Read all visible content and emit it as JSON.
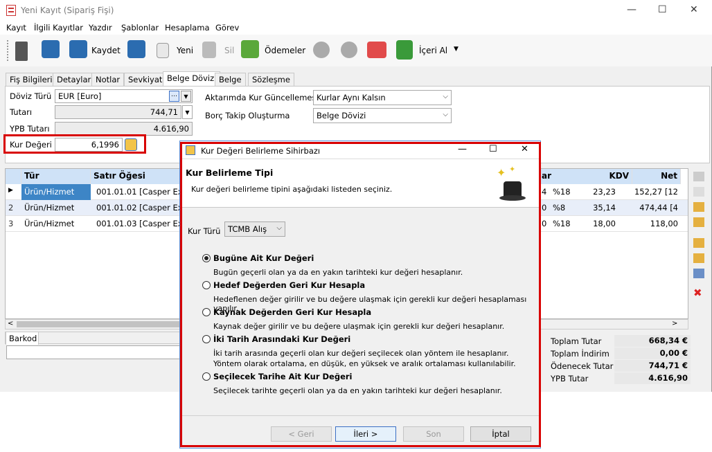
{
  "window": {
    "title": "Yeni Kayıt (Sipariş Fişi)",
    "controls": {
      "minimize": "—",
      "maximize": "☐",
      "close": "✕"
    }
  },
  "menu": [
    "Kayıt",
    "İlgili Kayıtlar",
    "Yazdır",
    "Şablonlar",
    "Hesaplama",
    "Görev"
  ],
  "toolbar": {
    "save": "Kaydet",
    "new": "Yeni",
    "delete": "Sil",
    "payments": "Ödemeler",
    "import": "İçeri Al"
  },
  "tabs": [
    "Fiş Bilgileri",
    "Detaylar",
    "Notlar",
    "Sevkiyat",
    "Belge Dövizi",
    "Belge",
    "Sözleşme"
  ],
  "form": {
    "currency_type_label": "Döviz Türü",
    "currency_type_value": "EUR [Euro]",
    "amount_label": "Tutarı",
    "amount_value": "744,71",
    "ypb_label": "YPB Tutarı",
    "ypb_value": "4.616,90",
    "rate_label": "Kur Değeri",
    "rate_value": "6,1996",
    "update_label": "Aktarımda Kur Güncellemesi",
    "update_value": "Kurlar Aynı Kalsın",
    "debt_label": "Borç Takip Oluşturma",
    "debt_value": "Belge Dövizi"
  },
  "grid": {
    "headers": {
      "type": "Tür",
      "item": "Satır Öğesi",
      "col_partial": "ar",
      "kdv": "KDV",
      "net": "Net"
    },
    "rows": [
      {
        "num": "1",
        "type": "Ürün/Hizmet",
        "item": "001.01.01 [Casper Excalib",
        "q": "4",
        "rate": "%18",
        "kdv": "23,23",
        "net": "152,27 [12"
      },
      {
        "num": "2",
        "type": "Ürün/Hizmet",
        "item": "001.01.02 [Casper Excalib",
        "q": "0",
        "rate": "%8",
        "kdv": "35,14",
        "net": "474,44 [4"
      },
      {
        "num": "3",
        "type": "Ürün/Hizmet",
        "item": "001.01.03 [Casper Excalib",
        "q": "0",
        "rate": "%18",
        "kdv": "18,00",
        "net": "118,00"
      }
    ]
  },
  "barcode_label": "Barkod",
  "totals": [
    {
      "label": "Toplam Tutar",
      "value": "668,34 €"
    },
    {
      "label": "Toplam İndirim",
      "value": "0,00 €"
    },
    {
      "label": "Ödenecek Tutar",
      "value": "744,71 €"
    },
    {
      "label": "YPB Tutar",
      "value": "4.616,90"
    }
  ],
  "dialog": {
    "title": "Kur Değeri Belirleme Sihirbazı",
    "heading": "Kur Belirleme Tipi",
    "subheading": "Kur değeri belirleme tipini aşağıdaki listeden seçiniz.",
    "rate_type_label": "Kur Türü",
    "rate_type_value": "TCMB Alış",
    "options": [
      {
        "title": "Bugüne Ait Kur Değeri",
        "desc": "Bugün geçerli olan ya da en yakın tarihteki kur değeri hesaplanır.",
        "desc2": ""
      },
      {
        "title": "Hedef Değerden Geri Kur Hesapla",
        "desc": "Hedeflenen değer girilir ve bu değere ulaşmak için gerekli kur değeri hesaplaması yapılır.",
        "desc2": ""
      },
      {
        "title": "Kaynak Değerden Geri Kur Hesapla",
        "desc": "Kaynak değer girilir ve bu değere ulaşmak için gerekli kur değeri hesaplanır.",
        "desc2": ""
      },
      {
        "title": "İki Tarih Arasındaki Kur Değeri",
        "desc": "İki tarih arasında geçerli olan kur değeri seçilecek olan yöntem ile hesaplanır.",
        "desc2": "Yöntem olarak ortalama, en düşük, en yüksek ve aralık ortalaması kullanılabilir."
      },
      {
        "title": "Seçilecek Tarihe Ait Kur Değeri",
        "desc": "Seçilecek tarihte geçerli olan ya da en yakın tarihteki kur değeri hesaplanır.",
        "desc2": ""
      }
    ],
    "selected_option": 0,
    "buttons": {
      "back": "< Geri",
      "next": "İleri >",
      "finish": "Son",
      "cancel": "İptal"
    }
  },
  "colors": {
    "highlight_red": "#d80000",
    "grid_header": "#cfe2f7",
    "selected_row": "#3d85c6"
  }
}
